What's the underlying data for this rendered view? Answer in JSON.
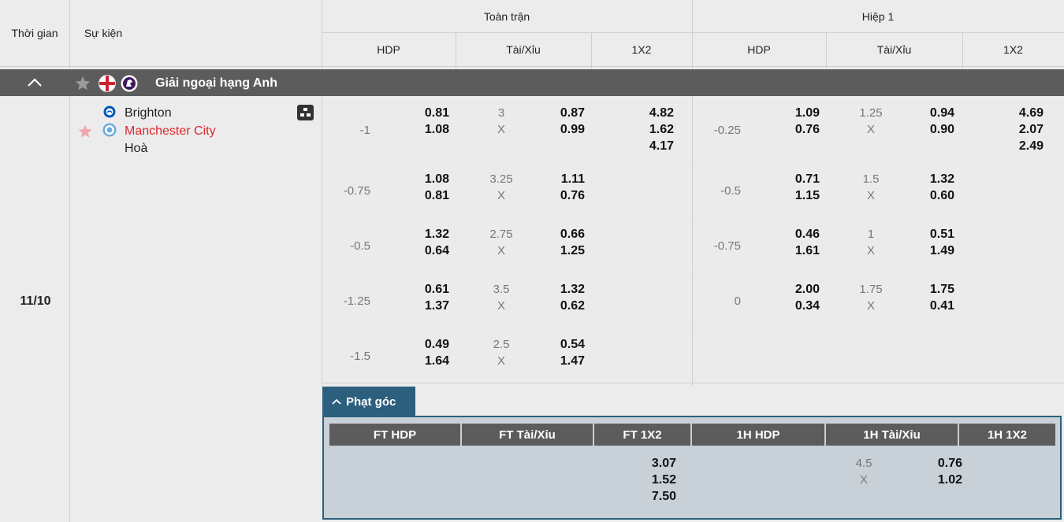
{
  "header": {
    "time_col": "Thời gian",
    "event_col": "Sự kiện",
    "full_match": "Toàn trận",
    "first_half": "Hiệp 1",
    "sub": [
      "HDP",
      "Tài/Xỉu",
      "1X2",
      "HDP",
      "Tài/Xỉu",
      "1X2"
    ]
  },
  "league": {
    "name": "Giải ngoại hạng Anh"
  },
  "match": {
    "date": "11/10",
    "home": "Brighton",
    "away": "Manchester City",
    "draw": "Hoà"
  },
  "rows": [
    {
      "ft_hdp": "-1",
      "ft_hdp_home": "0.81",
      "ft_hdp_away": "1.08",
      "ft_ou_line": "3",
      "ft_ou_x": "X",
      "ft_ou_over": "0.87",
      "ft_ou_under": "0.99",
      "ft_1x2": [
        "4.82",
        "1.62",
        "4.17"
      ],
      "h1_hdp": "-0.25",
      "h1_hdp_home": "1.09",
      "h1_hdp_away": "0.76",
      "h1_ou_line": "1.25",
      "h1_ou_x": "X",
      "h1_ou_over": "0.94",
      "h1_ou_under": "0.90",
      "h1_1x2": [
        "4.69",
        "2.07",
        "2.49"
      ]
    },
    {
      "ft_hdp": "-0.75",
      "ft_hdp_home": "1.08",
      "ft_hdp_away": "0.81",
      "ft_ou_line": "3.25",
      "ft_ou_x": "X",
      "ft_ou_over": "1.11",
      "ft_ou_under": "0.76",
      "h1_hdp": "-0.5",
      "h1_hdp_home": "0.71",
      "h1_hdp_away": "1.15",
      "h1_ou_line": "1.5",
      "h1_ou_x": "X",
      "h1_ou_over": "1.32",
      "h1_ou_under": "0.60"
    },
    {
      "ft_hdp": "-0.5",
      "ft_hdp_home": "1.32",
      "ft_hdp_away": "0.64",
      "ft_ou_line": "2.75",
      "ft_ou_x": "X",
      "ft_ou_over": "0.66",
      "ft_ou_under": "1.25",
      "h1_hdp": "-0.75",
      "h1_hdp_home": "0.46",
      "h1_hdp_away": "1.61",
      "h1_ou_line": "1",
      "h1_ou_x": "X",
      "h1_ou_over": "0.51",
      "h1_ou_under": "1.49"
    },
    {
      "ft_hdp": "-1.25",
      "ft_hdp_home": "0.61",
      "ft_hdp_away": "1.37",
      "ft_ou_line": "3.5",
      "ft_ou_x": "X",
      "ft_ou_over": "1.32",
      "ft_ou_under": "0.62",
      "h1_hdp": "0",
      "h1_hdp_home": "2.00",
      "h1_hdp_away": "0.34",
      "h1_ou_line": "1.75",
      "h1_ou_x": "X",
      "h1_ou_over": "1.75",
      "h1_ou_under": "0.41"
    },
    {
      "ft_hdp": "-1.5",
      "ft_hdp_home": "0.49",
      "ft_hdp_away": "1.64",
      "ft_ou_line": "2.5",
      "ft_ou_x": "X",
      "ft_ou_over": "0.54",
      "ft_ou_under": "1.47"
    }
  ],
  "corners": {
    "tab_label": "Phạt góc",
    "headers": [
      "FT HDP",
      "FT Tài/Xỉu",
      "FT 1X2",
      "1H HDP",
      "1H Tài/Xỉu",
      "1H 1X2"
    ],
    "ft_1x2": [
      "3.07",
      "1.52",
      "7.50"
    ],
    "h1_ou_line": "4.5",
    "h1_ou_x": "X",
    "h1_ou_over": "0.76",
    "h1_ou_under": "1.02"
  },
  "colors": {
    "league_bar": "#5c5c5c",
    "away_team": "#e0262d",
    "corner_accent": "#2c5f7d"
  }
}
